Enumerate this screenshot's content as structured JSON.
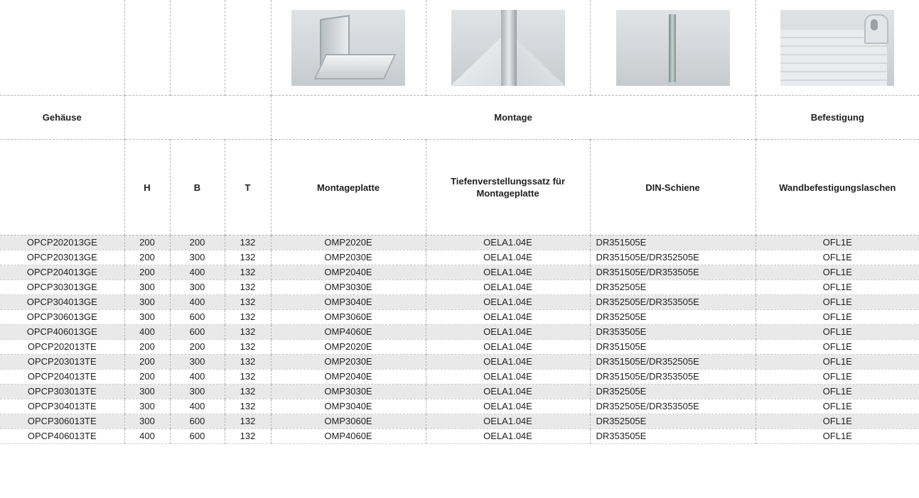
{
  "sections": {
    "gehaeuse": "Gehäuse",
    "montage": "Montage",
    "befestigung": "Befestigung"
  },
  "headers": {
    "h": "H",
    "b": "B",
    "t": "T",
    "montageplatte": "Montageplatte",
    "tiefenverstellung": "Tiefenverstellungssatz für Montageplatte",
    "din": "DIN-Schiene",
    "wandbefestigung": "Wandbefestigungslaschen"
  },
  "rows": [
    {
      "model": "OPCP202013GE",
      "h": "200",
      "b": "200",
      "t": "132",
      "mp": "OMP2020E",
      "tv": "OELA1.04E",
      "din": "DR351505E",
      "wb": "OFL1E"
    },
    {
      "model": "OPCP203013GE",
      "h": "200",
      "b": "300",
      "t": "132",
      "mp": "OMP2030E",
      "tv": "OELA1.04E",
      "din": "DR351505E/DR352505E",
      "wb": "OFL1E"
    },
    {
      "model": "OPCP204013GE",
      "h": "200",
      "b": "400",
      "t": "132",
      "mp": "OMP2040E",
      "tv": "OELA1.04E",
      "din": "DR351505E/DR353505E",
      "wb": "OFL1E"
    },
    {
      "model": "OPCP303013GE",
      "h": "300",
      "b": "300",
      "t": "132",
      "mp": "OMP3030E",
      "tv": "OELA1.04E",
      "din": "DR352505E",
      "wb": "OFL1E"
    },
    {
      "model": "OPCP304013GE",
      "h": "300",
      "b": "400",
      "t": "132",
      "mp": "OMP3040E",
      "tv": "OELA1.04E",
      "din": "DR352505E/DR353505E",
      "wb": "OFL1E"
    },
    {
      "model": "OPCP306013GE",
      "h": "300",
      "b": "600",
      "t": "132",
      "mp": "OMP3060E",
      "tv": "OELA1.04E",
      "din": "DR352505E",
      "wb": "OFL1E"
    },
    {
      "model": "OPCP406013GE",
      "h": "400",
      "b": "600",
      "t": "132",
      "mp": "OMP4060E",
      "tv": "OELA1.04E",
      "din": "DR353505E",
      "wb": "OFL1E"
    },
    {
      "model": "OPCP202013TE",
      "h": "200",
      "b": "200",
      "t": "132",
      "mp": "OMP2020E",
      "tv": "OELA1.04E",
      "din": "DR351505E",
      "wb": "OFL1E"
    },
    {
      "model": "OPCP203013TE",
      "h": "200",
      "b": "300",
      "t": "132",
      "mp": "OMP2030E",
      "tv": "OELA1.04E",
      "din": "DR351505E/DR352505E",
      "wb": "OFL1E"
    },
    {
      "model": "OPCP204013TE",
      "h": "200",
      "b": "400",
      "t": "132",
      "mp": "OMP2040E",
      "tv": "OELA1.04E",
      "din": "DR351505E/DR353505E",
      "wb": "OFL1E"
    },
    {
      "model": "OPCP303013TE",
      "h": "300",
      "b": "300",
      "t": "132",
      "mp": "OMP3030E",
      "tv": "OELA1.04E",
      "din": "DR352505E",
      "wb": "OFL1E"
    },
    {
      "model": "OPCP304013TE",
      "h": "300",
      "b": "400",
      "t": "132",
      "mp": "OMP3040E",
      "tv": "OELA1.04E",
      "din": "DR352505E/DR353505E",
      "wb": "OFL1E"
    },
    {
      "model": "OPCP306013TE",
      "h": "300",
      "b": "600",
      "t": "132",
      "mp": "OMP3060E",
      "tv": "OELA1.04E",
      "din": "DR352505E",
      "wb": "OFL1E"
    },
    {
      "model": "OPCP406013TE",
      "h": "400",
      "b": "600",
      "t": "132",
      "mp": "OMP4060E",
      "tv": "OELA1.04E",
      "din": "DR353505E",
      "wb": "OFL1E"
    }
  ]
}
